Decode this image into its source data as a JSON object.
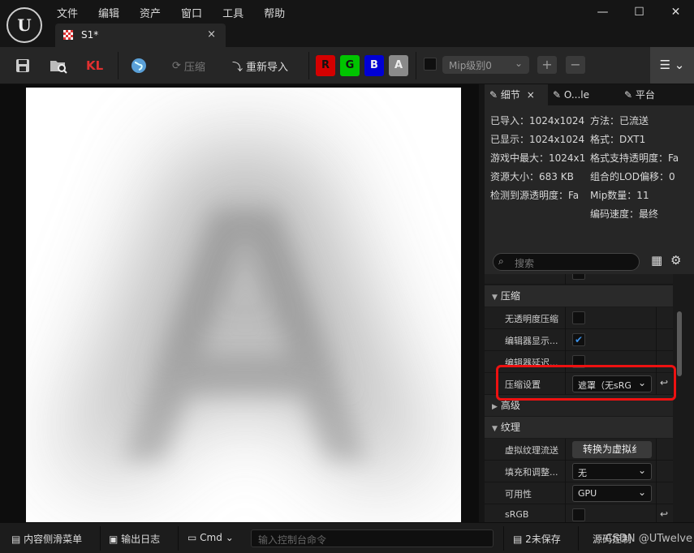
{
  "menubar": [
    "文件",
    "编辑",
    "资产",
    "窗口",
    "工具",
    "帮助"
  ],
  "window_controls": {
    "minimize": "—",
    "maximize": "☐",
    "close": "✕"
  },
  "tab": {
    "label": "S1*",
    "close": "×"
  },
  "toolbar": {
    "compress_label": "压缩",
    "reimport_label": "重新导入",
    "kl_label": "KL",
    "channels": [
      {
        "label": "R",
        "color": "#d40000"
      },
      {
        "label": "G",
        "color": "#00c400"
      },
      {
        "label": "B",
        "color": "#0000d4"
      },
      {
        "label": "A",
        "color": "#8a8a8a"
      }
    ],
    "mip_value": "Mip级别0",
    "plus": "+",
    "minus": "−",
    "menu_label": "☰ ⌄"
  },
  "details": {
    "tabs": [
      "细节",
      "O...le",
      "平台"
    ],
    "tab_close": "×",
    "info_left": [
      "已导入：1024x1024",
      "已显示：1024x1024",
      "游戏中最大：1024x1",
      "资源大小：683 KB",
      "检测到源透明度：Fa"
    ],
    "info_right": [
      "方法：已流送",
      "格式：DXT1",
      "格式支持透明度：Fa",
      "组合的LOD偏移：0",
      "Mip数量：11",
      "编码速度：最终"
    ],
    "search_placeholder": "搜索",
    "sections": {
      "compression": "压缩",
      "advanced": "高级",
      "texture": "纹理"
    },
    "props": {
      "no_alpha": "无透明度压缩",
      "editor_show": "编辑器显示...",
      "editor_defer": "编辑器延迟...",
      "compression_settings": "压缩设置",
      "compression_value": "遮罩（无sRG",
      "virtual_streaming": "虚拟纹理流送",
      "convert_button": "转换为虚拟纟",
      "fill_adjust": "填充和调整...",
      "fill_value": "无",
      "availability": "可用性",
      "availability_value": "GPU",
      "srgb": "sRGB"
    }
  },
  "statusbar": {
    "drawer": "内容侧滑菜单",
    "output_log": "输出日志",
    "cmd": "Cmd",
    "console_placeholder": "输入控制台命令",
    "unsaved": "2未保存",
    "source_control": "源码控制",
    "watermark": "CSDN @UTwelve"
  }
}
